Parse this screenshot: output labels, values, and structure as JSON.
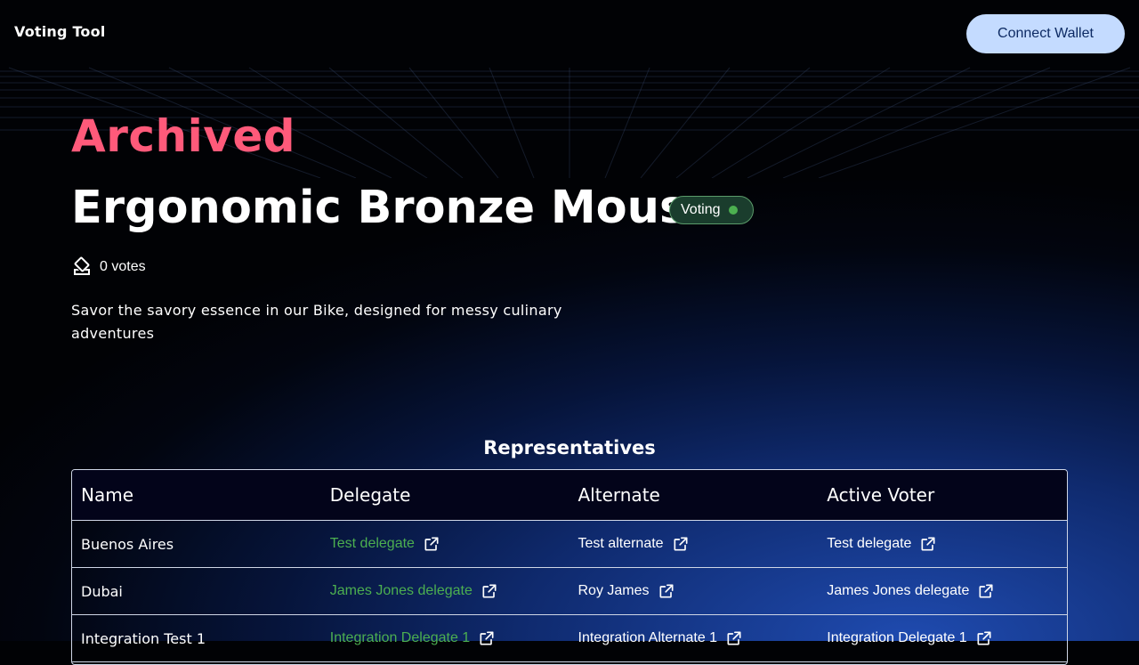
{
  "header": {
    "brand": "Voting Tool",
    "connect_label": "Connect Wallet"
  },
  "proposal": {
    "status_heading": "Archived",
    "title": "Ergonomic Bronze Mouse",
    "badge": "Voting",
    "votes": "0 votes",
    "description": "Savor the savory essence in our Bike, designed for messy culinary adventures"
  },
  "representatives": {
    "title": "Representatives",
    "columns": [
      "Name",
      "Delegate",
      "Alternate",
      "Active Voter"
    ],
    "rows": [
      {
        "name": "Buenos Aires",
        "delegate": "Test delegate",
        "alternate": "Test alternate",
        "active_voter": "Test delegate"
      },
      {
        "name": "Dubai",
        "delegate": "James Jones delegate",
        "alternate": "Roy James",
        "active_voter": "James Jones delegate"
      },
      {
        "name": "Integration Test 1",
        "delegate": "Integration Delegate 1",
        "alternate": "Integration Alternate 1",
        "active_voter": "Integration Delegate 1"
      }
    ]
  },
  "colors": {
    "archived": "#ff5a7a",
    "accent_green": "#4caf50",
    "button_bg": "#c4dbff"
  }
}
